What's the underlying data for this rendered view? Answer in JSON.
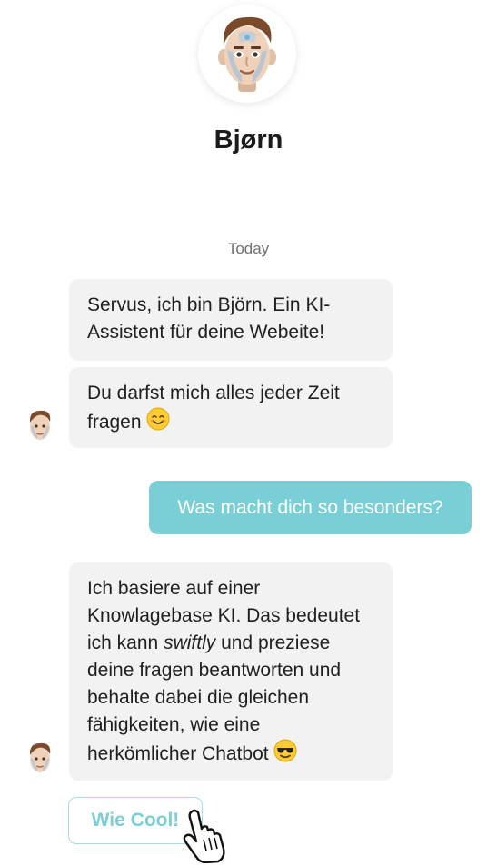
{
  "header": {
    "bot_name": "Bjørn",
    "avatar_icon": "robot-face-avatar-icon"
  },
  "chat": {
    "date_separator": "Today",
    "messages": [
      {
        "sender": "bot",
        "text": "Servus, ich bin Björn. Ein KI-Assistent für deine Webeite!"
      },
      {
        "sender": "bot",
        "text": "Du darfst mich alles jeder Zeit fragen",
        "emoji": "smiling-face-icon"
      },
      {
        "sender": "user",
        "text": "Was macht dich so besonders?"
      },
      {
        "sender": "bot",
        "text_before": "Ich basiere auf einer Knowlagebase KI. Das bedeutet ich kann ",
        "text_emphasis": "swiftly",
        "text_after": " und preziese deine fragen beantworten und behalte dabei die gleichen fähigkeiten, wie eine herkömlicher Chatbot",
        "emoji": "sunglasses-face-icon"
      }
    ],
    "quick_replies": [
      "Wie Cool!"
    ]
  },
  "colors": {
    "accent": "#7acfd6",
    "bot_bubble": "#f2f2f2",
    "text": "#1f1f1f",
    "muted": "#6f6f6f"
  },
  "cursor_icon": "hand-pointer-icon"
}
